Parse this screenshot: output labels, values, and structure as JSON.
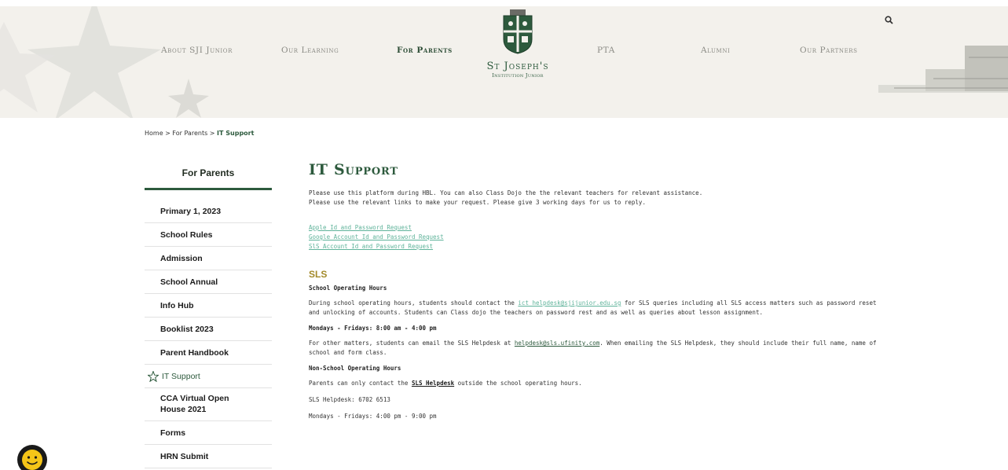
{
  "header": {
    "nav": [
      {
        "label": "About SJI Junior"
      },
      {
        "label": "Our Learning"
      },
      {
        "label": "For Parents"
      },
      {
        "label": "PTA"
      },
      {
        "label": "Alumni"
      },
      {
        "label": "Our Partners"
      }
    ],
    "school_name": "St Joseph's",
    "school_sub": "Institution Junior",
    "active_nav": "For Parents"
  },
  "breadcrumb": {
    "home": "Home",
    "sep1": ">",
    "parent": "For Parents",
    "sep2": ">",
    "current": "IT Support"
  },
  "sidebar": {
    "title": "For Parents",
    "items": [
      {
        "label": "Primary 1, 2023"
      },
      {
        "label": "School Rules"
      },
      {
        "label": "Admission"
      },
      {
        "label": "School Annual"
      },
      {
        "label": "Info Hub"
      },
      {
        "label": "Booklist 2023"
      },
      {
        "label": "Parent Handbook"
      },
      {
        "label": "IT Support"
      },
      {
        "label": "CCA Virtual Open House 2021"
      },
      {
        "label": "Forms"
      },
      {
        "label": "HRN Submit"
      }
    ]
  },
  "main": {
    "title": "IT Support",
    "intro_line1": "Please use this platform during HBL. You can also Class Dojo the the relevant teachers for relevant assistance.",
    "intro_line2": "Please use the relevant links to make your request. Please give 3 working days for us to reply.",
    "links": [
      {
        "label": "Apple Id and Password Request"
      },
      {
        "label": "Google Account Id and Password Request"
      },
      {
        "label": "SlS Account Id and Password Request"
      }
    ],
    "sls_title": "SLS",
    "school_hours_heading": "School Operating Hours",
    "school_hours_p1_a": "During school operating hours, students should contact the ",
    "school_hours_email": "ict_helpdesk@sjijunior.edu.sg",
    "school_hours_p1_b": " for SLS queries including all SLS access matters such as password reset",
    "school_hours_p1_c": "and unlocking of accounts. Students can Class dojo the teachers on password rest and as well as queries about lesson assignment.",
    "weekday_hours": "Mondays - Fridays: 8:00 am - 4:00 pm",
    "other_a": "For other matters, students can email the SLS Helpdesk at ",
    "other_email": "helpdesk@sls.ufinity.com",
    "other_b": ". When emailing the SLS Helpdesk, they should include their full name, name of",
    "other_c": "school and form class.",
    "non_school_heading": "Non-School Operating Hours",
    "parents_a": "Parents can only contact the ",
    "parents_link": "SLS Helpdesk",
    "parents_b": " outside the school operating hours.",
    "helpdesk_phone": "SLS Helpdesk: 6702 6513",
    "evening_hours": "Mondays - Fridays: 4:00 pm - 9:00 pm"
  },
  "colors": {
    "accent_green": "#2d5a3d",
    "link_teal": "#5fb39a",
    "section_gold": "#a38a2a"
  }
}
